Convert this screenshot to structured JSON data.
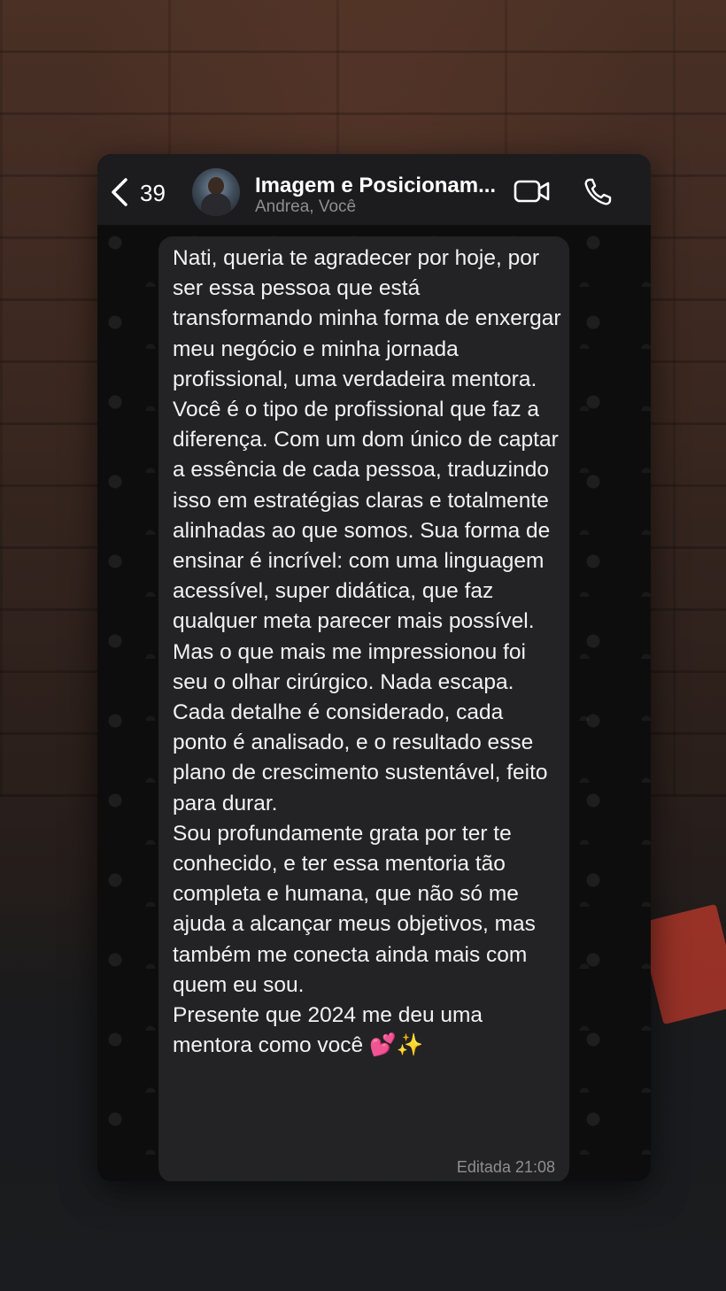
{
  "header": {
    "back_count": "39",
    "title": "Imagem e Posicionam...",
    "subtitle": "Andrea, Você",
    "icons": [
      "chevron-left-icon",
      "video-call-icon",
      "phone-call-icon"
    ]
  },
  "message": {
    "paragraphs": [
      "Nati, queria te agradecer por hoje, por ser essa pessoa que está transformando minha forma de enxergar meu negócio e minha jornada profissional, uma verdadeira mentora.",
      "Você é o tipo de profissional que faz a diferença. Com um dom único de captar a essência de cada pessoa, traduzindo isso em estratégias claras e totalmente alinhadas ao que somos. Sua forma de ensinar é incrível: com uma linguagem acessível, super didática, que faz qualquer meta parecer mais possível.",
      "Mas o que mais me impressionou foi seu o olhar cirúrgico. Nada escapa. Cada detalhe é considerado, cada ponto é analisado, e o resultado esse plano de crescimento sustentável, feito para durar.",
      "Sou profundamente grata por ter te conhecido, e ter essa mentoria tão completa e humana, que não só me ajuda a alcançar meus objetivos, mas também me conecta ainda mais com quem eu sou.",
      "Presente que 2024 me deu uma mentora como você 💕✨"
    ],
    "meta": "Editada 21:08"
  },
  "colors": {
    "header_bg": "#1c1c1e",
    "bubble_bg": "#232325",
    "text": "#f2f2f2",
    "muted": "#8e8e93"
  }
}
